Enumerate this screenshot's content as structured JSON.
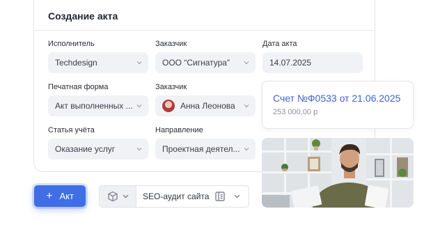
{
  "form": {
    "title": "Создание акта",
    "fields": [
      {
        "label": "Исполнитель",
        "value": "Techdesign"
      },
      {
        "label": "Заказчик",
        "value": "ООО “Сигнатура”"
      },
      {
        "label": "Дата акта",
        "value": "14.07.2025"
      },
      {
        "label": "Печатная форма",
        "value": "Акт выполненных ..."
      },
      {
        "label": "Заказчик",
        "value": "Анна Леонова"
      },
      {
        "label": "Статья учёта",
        "value": "Оказание услуг"
      },
      {
        "label": "Направление",
        "value": "Проектная деятел..."
      }
    ]
  },
  "invoice": {
    "title": "Счет №Ф0533 от 21.06.2025",
    "amount": "253 000,00 р"
  },
  "actions": {
    "add_label": "Акт",
    "project_value": "SEO-аудит сайта"
  },
  "colors": {
    "accent": "#3f6ee6",
    "link": "#3b63d8",
    "field_bg": "#f1f2f5"
  },
  "icons": [
    "chevron-down-icon",
    "plus-icon",
    "box-icon",
    "book-icon",
    "avatar"
  ]
}
